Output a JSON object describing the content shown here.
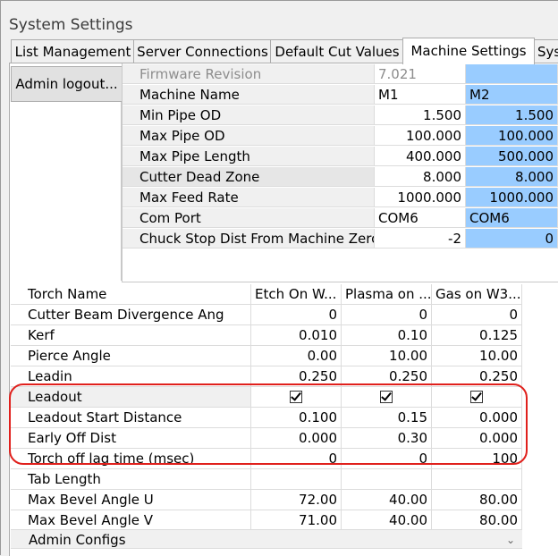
{
  "window": {
    "title": "System Settings"
  },
  "tabs": [
    {
      "label": "List Management"
    },
    {
      "label": "Server Connections"
    },
    {
      "label": "Default Cut Values"
    },
    {
      "label": "Machine Settings",
      "active": true
    },
    {
      "label": "Syst"
    }
  ],
  "admin_button": {
    "label": "Admin logout..."
  },
  "machine_table": {
    "rows": [
      {
        "name": "Firmware Revision",
        "v1": "7.021",
        "v2": ""
      },
      {
        "name": "Machine Name",
        "v1": "M1",
        "v2": "M2"
      },
      {
        "name": "Min Pipe OD",
        "v1": "1.500",
        "v2": "1.500"
      },
      {
        "name": "Max Pipe OD",
        "v1": "100.000",
        "v2": "100.000"
      },
      {
        "name": "Max Pipe Length",
        "v1": "400.000",
        "v2": "500.000"
      },
      {
        "name": "Cutter Dead Zone",
        "v1": "8.000",
        "v2": "8.000"
      },
      {
        "name": "Max Feed Rate",
        "v1": "1000.000",
        "v2": "1000.000"
      },
      {
        "name": "Com Port",
        "v1": "COM6",
        "v2": "COM6"
      },
      {
        "name": "Chuck Stop Dist From Machine Zero",
        "v1": "-2",
        "v2": "0"
      }
    ]
  },
  "torch_table": {
    "header": {
      "name": "Torch Name",
      "c1": "Etch On W...",
      "c2": "Plasma on ...",
      "c3": "Gas on W3..."
    },
    "rows": [
      {
        "name": "Cutter Beam Divergence Ang",
        "c1": "0",
        "c2": "0",
        "c3": "0"
      },
      {
        "name": "Kerf",
        "c1": "0.010",
        "c2": "0.10",
        "c3": "0.125"
      },
      {
        "name": "Pierce Angle",
        "c1": "0.00",
        "c2": "10.00",
        "c3": "10.00"
      },
      {
        "name": "Leadin",
        "c1": "0.250",
        "c2": "0.250",
        "c3": "0.250"
      },
      {
        "name": "Leadout",
        "c1": "",
        "c2": "",
        "c3": "",
        "checkbox": true,
        "checked": [
          true,
          true,
          true
        ]
      },
      {
        "name": "Leadout Start Distance",
        "c1": "0.100",
        "c2": "0.15",
        "c3": "0.000"
      },
      {
        "name": "Early Off Dist",
        "c1": "0.000",
        "c2": "0.30",
        "c3": "0.000"
      },
      {
        "name": "Torch off lag time (msec)",
        "c1": "0",
        "c2": "0",
        "c3": "100"
      },
      {
        "name": "Tab Length",
        "c1": "",
        "c2": "",
        "c3": ""
      },
      {
        "name": "Max Bevel Angle U",
        "c1": "72.00",
        "c2": "40.00",
        "c3": "80.00"
      },
      {
        "name": "Max Bevel Angle V",
        "c1": "71.00",
        "c2": "40.00",
        "c3": "80.00"
      }
    ],
    "footer": "Admin Configs"
  },
  "colors": {
    "selected_column": "#99ccff",
    "highlight_outline": "#e0201c"
  }
}
